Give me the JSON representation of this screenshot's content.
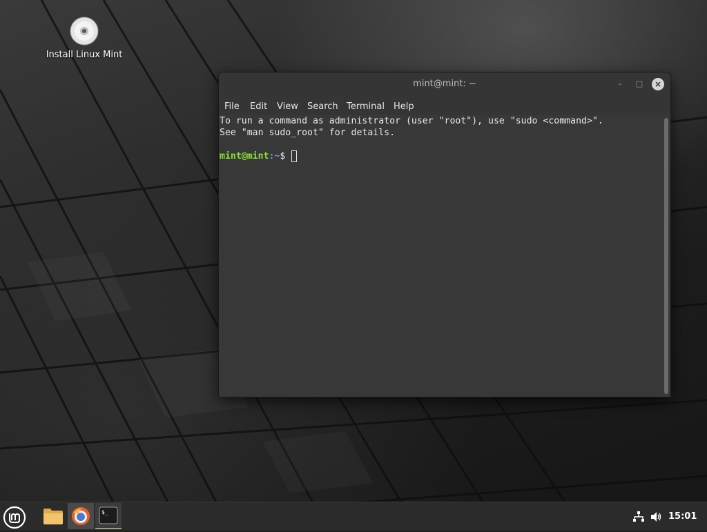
{
  "desktop": {
    "icons": [
      {
        "label": "Install Linux Mint",
        "icon": "cd-disc-icon"
      }
    ]
  },
  "terminal": {
    "title": "mint@mint: ~",
    "window_controls": {
      "minimize": "–",
      "maximize": "□",
      "close": "×"
    },
    "menu": [
      "File",
      "Edit",
      "View",
      "Search",
      "Terminal",
      "Help"
    ],
    "lines": [
      "To run a command as administrator (user \"root\"), use \"sudo <command>\".",
      "See \"man sudo_root\" for details."
    ],
    "prompt": {
      "user": "mint@mint",
      "path": ":~",
      "symbol": "$ "
    },
    "colors": {
      "user": "#8ae234",
      "path": "#729fcf",
      "background": "#383838"
    }
  },
  "panel": {
    "menu_icon": "linux-mint-logo-icon",
    "launchers": [
      {
        "name": "files",
        "icon": "folder-icon"
      },
      {
        "name": "browser",
        "icon": "firefox-icon"
      },
      {
        "name": "terminal",
        "icon": "terminal-icon"
      }
    ],
    "tray": {
      "network_icon": "network-icon",
      "volume_icon": "volume-icon"
    },
    "clock": "15:01"
  }
}
